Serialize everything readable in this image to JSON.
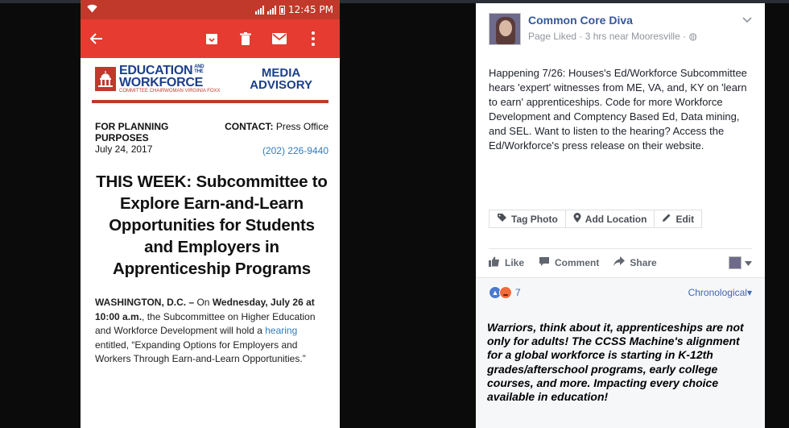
{
  "phone": {
    "status_time": "12:45 PM",
    "header_color": "#e53b30",
    "icons": [
      "back-arrow-icon",
      "archive-icon",
      "trash-icon",
      "mail-icon",
      "more-vert-icon"
    ],
    "email": {
      "org_line1": "EDUCATION",
      "org_line2": "WORKFORCE",
      "org_and_the": "AND THE",
      "org_small": "COMMITTEE CHAIRWOMAN VIRGINIA FOXX",
      "advisory_line1": "MEDIA",
      "advisory_line2": "ADVISORY",
      "planning": "FOR PLANNING PURPOSES",
      "date": "July 24, 2017",
      "contact_label": "CONTACT:",
      "contact_value": "Press Office",
      "phone": "(202) 226-9440",
      "headline": "THIS WEEK: Subcommittee to Explore Earn-and-Learn Opportunities for Students and Employers in Apprenticeship Programs",
      "body_dateline": "WASHINGTON, D.C. –",
      "body_on": " On ",
      "body_when": "Wednesday, July 26 at 10:00 a.m.",
      "body_rest": ", the Subcommittee on Higher Education and Workforce Development will hold a ",
      "body_link": "hearing",
      "body_end": " entitled, “Expanding Options for Employers and Workers Through Earn-and-Learn Opportunities.”"
    }
  },
  "post": {
    "page_name": "Common Core Diva",
    "sub_line": "Page Liked · 3 hrs near Mooresville ·",
    "text": "Happening 7/26: Houses's Ed/Workforce Subcommittee hears 'expert' witnesses from ME, VA, and, KY on 'learn to earn' apprenticeships. Code for more Workforce Development and Comptency Based Ed, Data mining, and SEL. Want to listen to the hearing? Access the Ed/Workforce's press release on their website.",
    "edit_buttons": [
      "Tag Photo",
      "Add Location",
      "Edit"
    ],
    "actions": [
      "Like",
      "Comment",
      "Share"
    ],
    "reaction_count": "7",
    "sort_label": "Chronological",
    "overlay_text": "Warriors, think about it, apprenticeships are not only for adults! The CCSS Machine's alignment for a global workforce is starting in K-12th grades/afterschool programs, early college courses, and more. Impacting every choice available in education!",
    "link_color": "#365899"
  }
}
